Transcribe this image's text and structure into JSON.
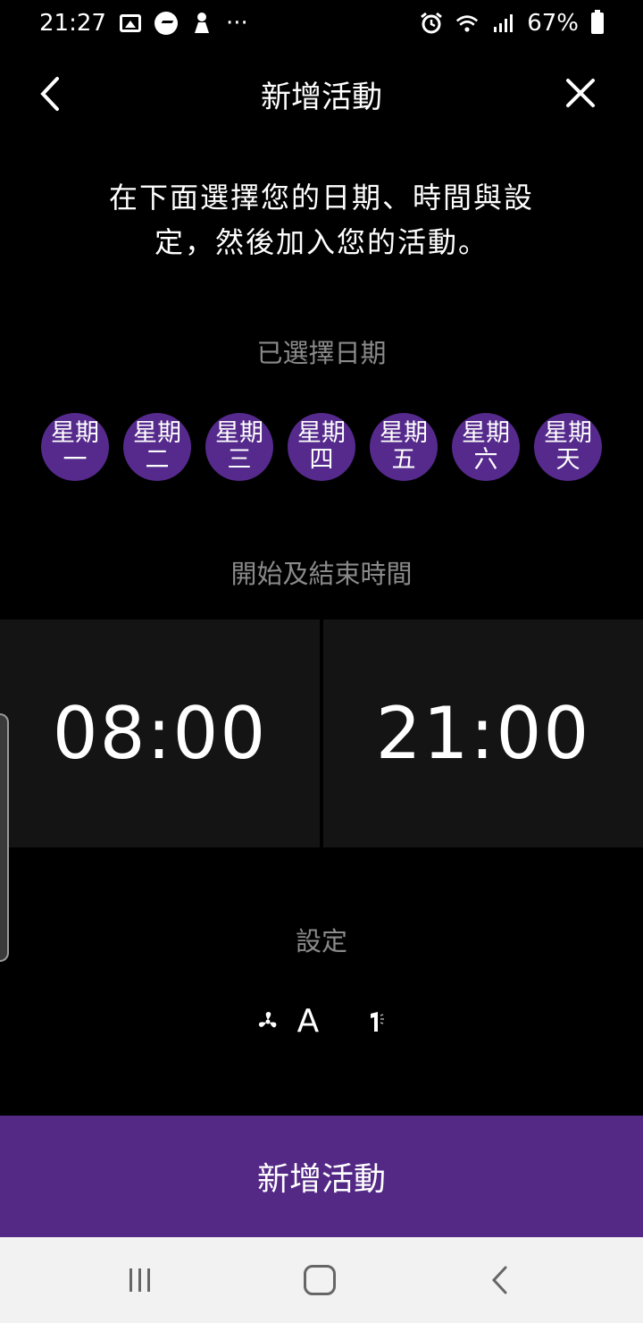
{
  "status_bar": {
    "time": "21:27",
    "more": "···",
    "battery": "67%"
  },
  "header": {
    "title": "新增活動"
  },
  "intro": {
    "line1": "在下面選擇您的日期、時間與設",
    "line2": "定，然後加入您的活動。"
  },
  "date_section": {
    "label": "已選擇日期",
    "days": [
      {
        "line1": "星期",
        "line2": "一"
      },
      {
        "line1": "星期",
        "line2": "二"
      },
      {
        "line1": "星期",
        "line2": "三"
      },
      {
        "line1": "星期",
        "line2": "四"
      },
      {
        "line1": "星期",
        "line2": "五"
      },
      {
        "line1": "星期",
        "line2": "六"
      },
      {
        "line1": "星期",
        "line2": "天"
      }
    ]
  },
  "time_section": {
    "label": "開始及結束時間",
    "start": "08:00",
    "end": "21:00"
  },
  "settings_section": {
    "label": "設定",
    "fan_mode": "A",
    "icons": [
      "fan-icon",
      "swing-icon"
    ]
  },
  "add_button": {
    "label": "新增活動"
  },
  "colors": {
    "accent": "#542986",
    "day_bubble": "#552a8c",
    "time_panel": "#141414",
    "muted_text": "#8a8a8a",
    "nav_bar": "#f2f2f2"
  }
}
